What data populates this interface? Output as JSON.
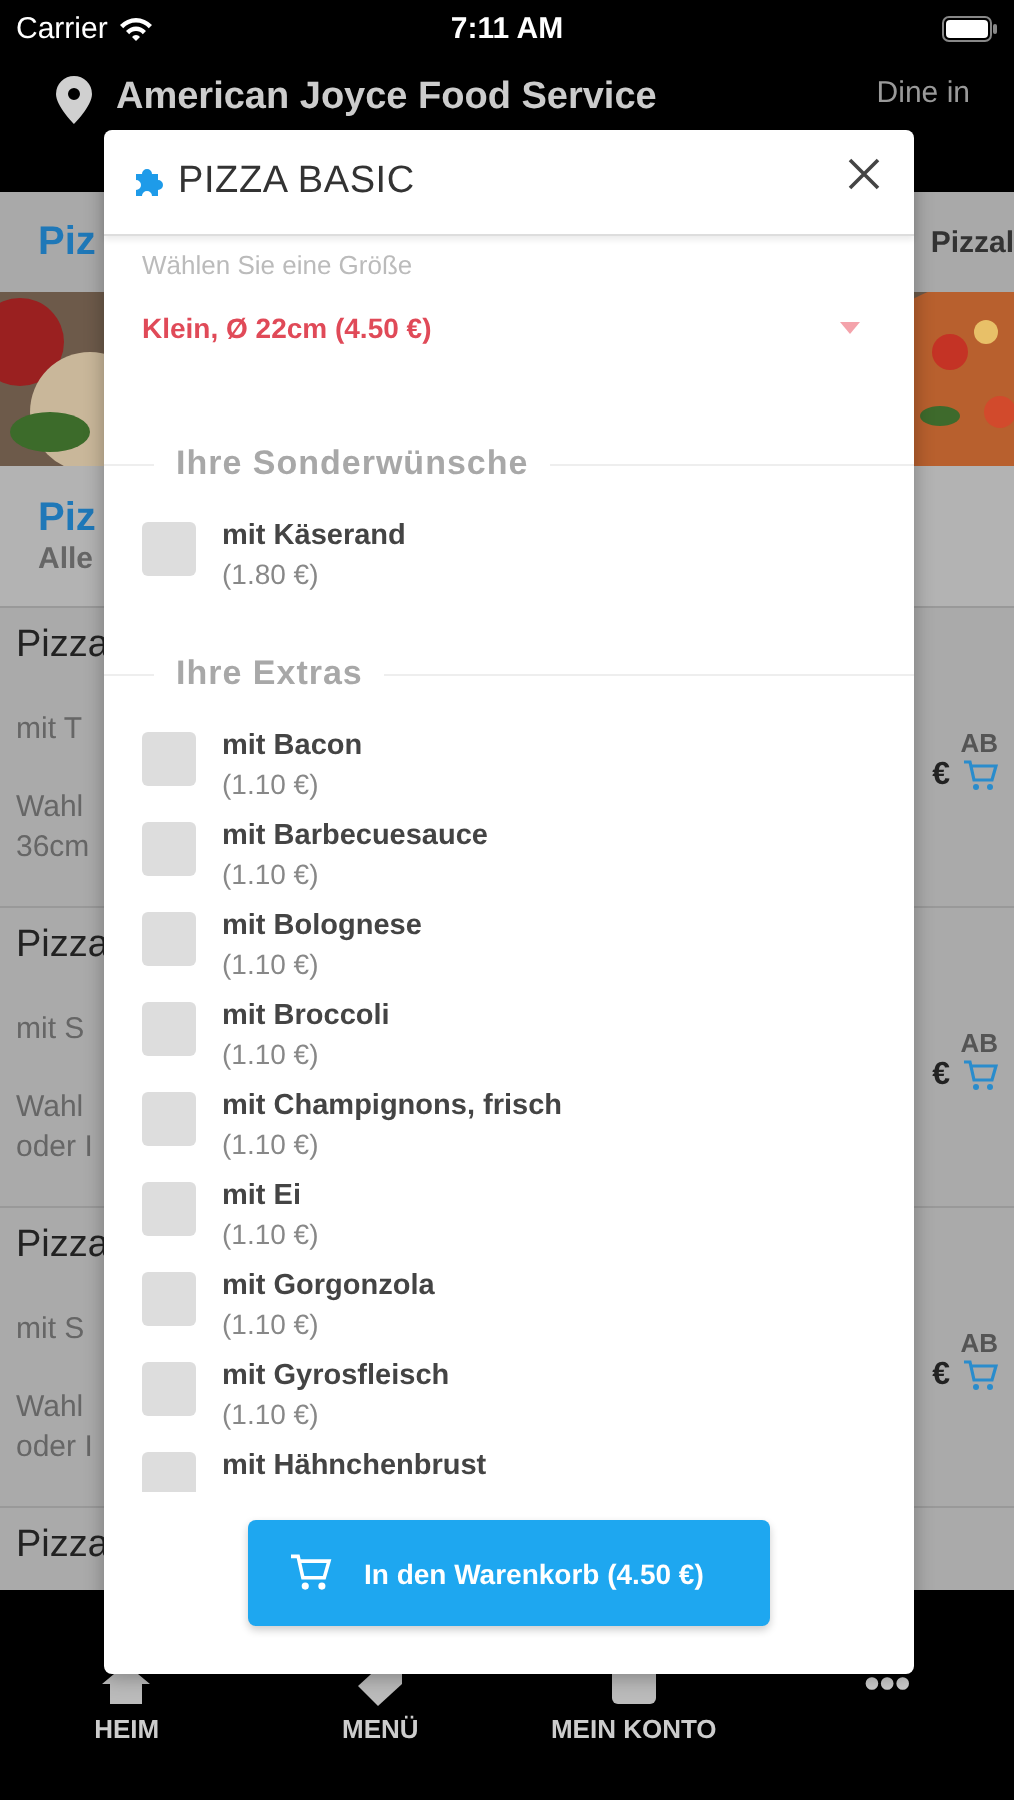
{
  "status_bar": {
    "carrier": "Carrier",
    "time": "7:11 AM"
  },
  "header": {
    "title": "American Joyce Food Service",
    "mode": "Dine in"
  },
  "background": {
    "category_left": "Piz",
    "category_right": "Pizzal",
    "section_title": "Piz",
    "section_subtitle": "Alle",
    "rows": [
      {
        "title": "Pizza",
        "line_1": "mit T",
        "line_2": "Wahl",
        "line_3": "36cm",
        "ab": "AB",
        "price": "€"
      },
      {
        "title": "Pizza",
        "line_1": "mit S",
        "line_2": "Wahl",
        "line_3": "oder I",
        "ab": "AB",
        "price": "€"
      },
      {
        "title": "Pizza",
        "line_1": "mit S",
        "line_2": "Wahl",
        "line_3": "oder I",
        "ab": "AB",
        "price": "€"
      },
      {
        "title": "Pizza"
      }
    ]
  },
  "modal": {
    "title": "PIZZA BASIC",
    "size_label": "Wählen Sie eine Größe",
    "size_value": "Klein, Ø 22cm (4.50 €)",
    "sections": [
      {
        "title": "Ihre Sonderwünsche",
        "options": [
          {
            "name": "mit Käserand",
            "price": "(1.80 €)",
            "checked": false
          }
        ]
      },
      {
        "title": "Ihre Extras",
        "options": [
          {
            "name": "mit Bacon",
            "price": "(1.10 €)",
            "checked": false
          },
          {
            "name": "mit Barbecuesauce",
            "price": "(1.10 €)",
            "checked": false
          },
          {
            "name": "mit Bolognese",
            "price": "(1.10 €)",
            "checked": false
          },
          {
            "name": "mit Broccoli",
            "price": "(1.10 €)",
            "checked": false
          },
          {
            "name": "mit Champignons, frisch",
            "price": "(1.10 €)",
            "checked": false
          },
          {
            "name": "mit Ei",
            "price": "(1.10 €)",
            "checked": false
          },
          {
            "name": "mit Gorgonzola",
            "price": "(1.10 €)",
            "checked": false
          },
          {
            "name": "mit Gyrosfleisch",
            "price": "(1.10 €)",
            "checked": false
          },
          {
            "name": "mit Hähnchenbrust",
            "checked": false
          }
        ]
      }
    ],
    "button": "In den Warenkorb (4.50 €)"
  },
  "tab_bar": [
    {
      "label": "HEIM",
      "kind": "home"
    },
    {
      "label": "MENÜ",
      "kind": "tag"
    },
    {
      "label": "MEIN KONTO",
      "kind": "account"
    },
    {
      "label": "•••",
      "kind": "more"
    }
  ]
}
